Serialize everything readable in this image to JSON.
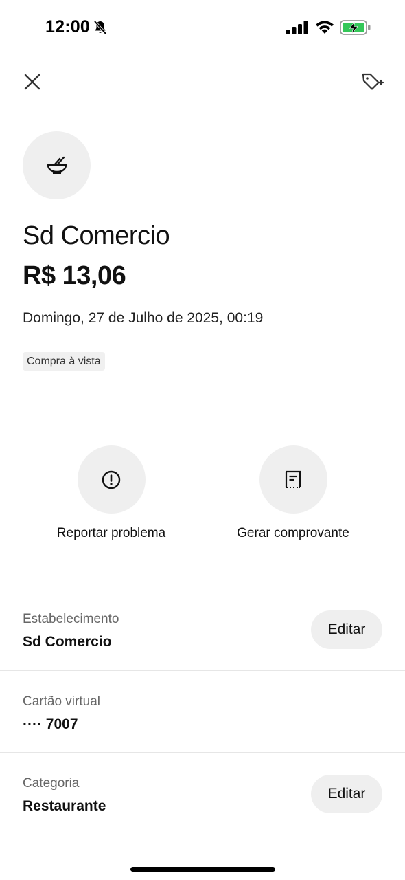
{
  "status_bar": {
    "time": "12:00",
    "icons": [
      "bell-slash-icon",
      "signal-icon",
      "wifi-icon",
      "battery-charging-icon"
    ],
    "battery_color": "#34c759"
  },
  "header": {
    "close_icon": "close-icon",
    "tag_icon": "tag-add-icon"
  },
  "transaction": {
    "category_icon": "bowl-icon",
    "merchant": "Sd Comercio",
    "amount": "R$ 13,06",
    "date": "Domingo, 27 de Julho de 2025, 00:19",
    "badge": "Compra à vista"
  },
  "actions": [
    {
      "label": "Reportar problema",
      "icon": "alert-circle-icon"
    },
    {
      "label": "Gerar comprovante",
      "icon": "receipt-icon"
    }
  ],
  "details": [
    {
      "label": "Estabelecimento",
      "value": "Sd Comercio",
      "button": "Editar"
    },
    {
      "label": "Cartão virtual",
      "value": "···· 7007"
    },
    {
      "label": "Categoria",
      "value": "Restaurante",
      "button": "Editar"
    }
  ]
}
